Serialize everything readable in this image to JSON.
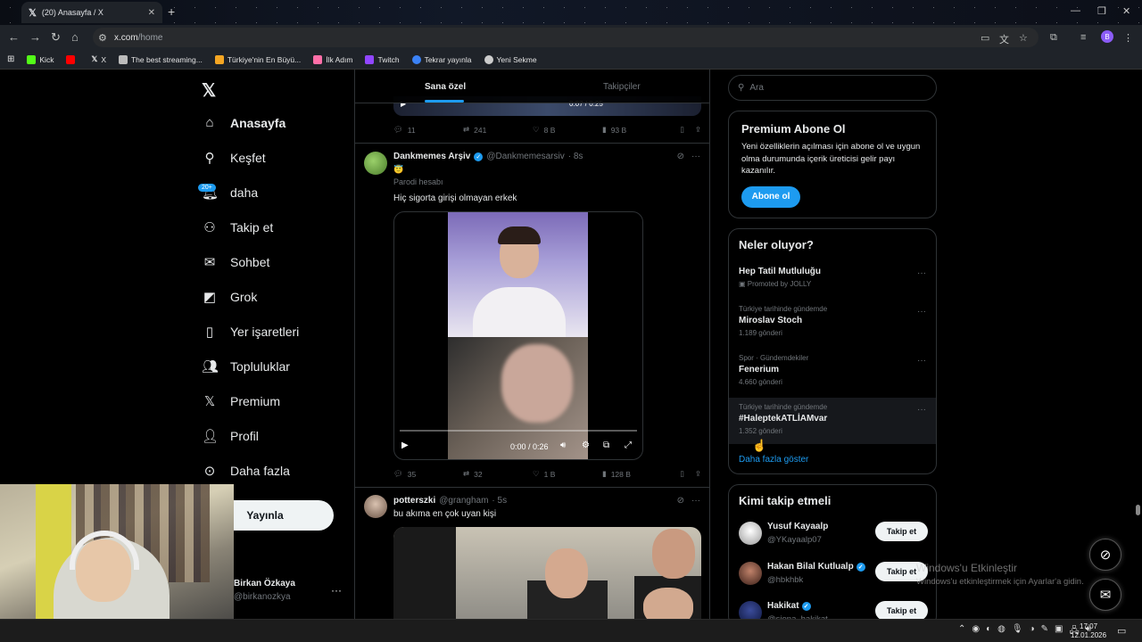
{
  "browser": {
    "tab_title": "(20) Anasayfa / X",
    "url_domain": "x.com",
    "url_path": "/home",
    "profile_initial": "B",
    "bookmarks": [
      {
        "label": "Kick",
        "color": "#53fc18"
      },
      {
        "label": "",
        "color": "#ff0000"
      },
      {
        "label": "X",
        "color": "#ffffff"
      },
      {
        "label": "The best streaming...",
        "color": "#bbbbbb"
      },
      {
        "label": "Türkiye'nin En Büyü...",
        "color": "#f5a623"
      },
      {
        "label": "İlk Adım",
        "color": "#ff6fa8"
      },
      {
        "label": "Twitch",
        "color": "#9146ff"
      },
      {
        "label": "Tekrar yayınla",
        "color": "#3b82f6"
      },
      {
        "label": "Yeni Sekme",
        "color": "#cccccc"
      }
    ]
  },
  "nav": {
    "items": [
      {
        "label": "Anasayfa",
        "icon": "home-icon"
      },
      {
        "label": "Keşfet",
        "icon": "search-icon"
      },
      {
        "label": "daha",
        "icon": "bell-icon"
      },
      {
        "label": "Takip et",
        "icon": "add-person-icon"
      },
      {
        "label": "Sohbet",
        "icon": "mail-icon"
      },
      {
        "label": "Grok",
        "icon": "grok-icon"
      },
      {
        "label": "Yer işaretleri",
        "icon": "bookmark-icon"
      },
      {
        "label": "Topluluklar",
        "icon": "people-icon"
      },
      {
        "label": "Premium",
        "icon": "x-icon"
      },
      {
        "label": "Profil",
        "icon": "person-icon"
      },
      {
        "label": "Daha fazla",
        "icon": "more-circle-icon"
      }
    ],
    "notif_badge": "20+",
    "post_button": "Yayınla",
    "profile_name": "Birkan Özkaya",
    "profile_handle": "@birkanozkya"
  },
  "timeline": {
    "tabs": [
      "Sana özel",
      "Takipçiler"
    ],
    "prev_time": "0:07 / 0:25",
    "prev_actions": {
      "replies": "11",
      "reposts": "241",
      "likes": "8 B",
      "views": "93 B"
    },
    "tweets": [
      {
        "name": "Dankmemes Arşiv",
        "handle": "@Dankmemesarsiv",
        "time": "· 8s",
        "emoji": "😇",
        "label": "Parodi hesabı",
        "text": "Hiç sigorta girişi olmayan erkek",
        "video_time": "0:00 / 0:26",
        "video_progress": 0,
        "replies": "35",
        "reposts": "32",
        "likes": "1 B",
        "views": "128 B"
      },
      {
        "name": "potterszki",
        "handle": "@grangham",
        "time": "· 5s",
        "text": "bu akıma en çok uyan kişi"
      }
    ]
  },
  "right": {
    "search_placeholder": "Ara",
    "premium": {
      "title": "Premium Abone Ol",
      "body": "Yeni özelliklerin açılması için abone ol ve uygun olma durumunda içerik üreticisi gelir payı kazanılır.",
      "button": "Abone ol"
    },
    "trends": {
      "title": "Neler oluyor?",
      "items": [
        {
          "meta": "",
          "title": "Hep Tatil Mutluluğu",
          "count": "Promoted by JOLLY"
        },
        {
          "meta": "Türkiye tarihinde gündemde",
          "title": "Miroslav Stoch",
          "count": "1.189 gönderi"
        },
        {
          "meta": "Spor · Gündemdekiler",
          "title": "Fenerium",
          "count": "4.660 gönderi"
        },
        {
          "meta": "Türkiye tarihinde gündemde",
          "title": "#HaleptekATLİAMvar",
          "count": "1.352 gönderi"
        }
      ],
      "show_more": "Daha fazla göster"
    },
    "who_to_follow": {
      "title": "Kimi takip etmeli",
      "follow_label": "Takip et",
      "items": [
        {
          "name": "Yusuf Kayaalp",
          "handle": "@YKayaalp07",
          "verified": false
        },
        {
          "name": "Hakan Bilal Kutlualp",
          "handle": "@hbkhbk",
          "verified": true
        },
        {
          "name": "Hakikat",
          "handle": "@siena_hakikat",
          "verified": true
        }
      ]
    }
  },
  "watermark": {
    "title": "Windows'u Etkinleştir",
    "subtitle": "Windows'u etkinleştirmek için Ayarlar'a gidin."
  },
  "taskbar": {
    "time": "17:07",
    "date": "12.01.2026"
  }
}
